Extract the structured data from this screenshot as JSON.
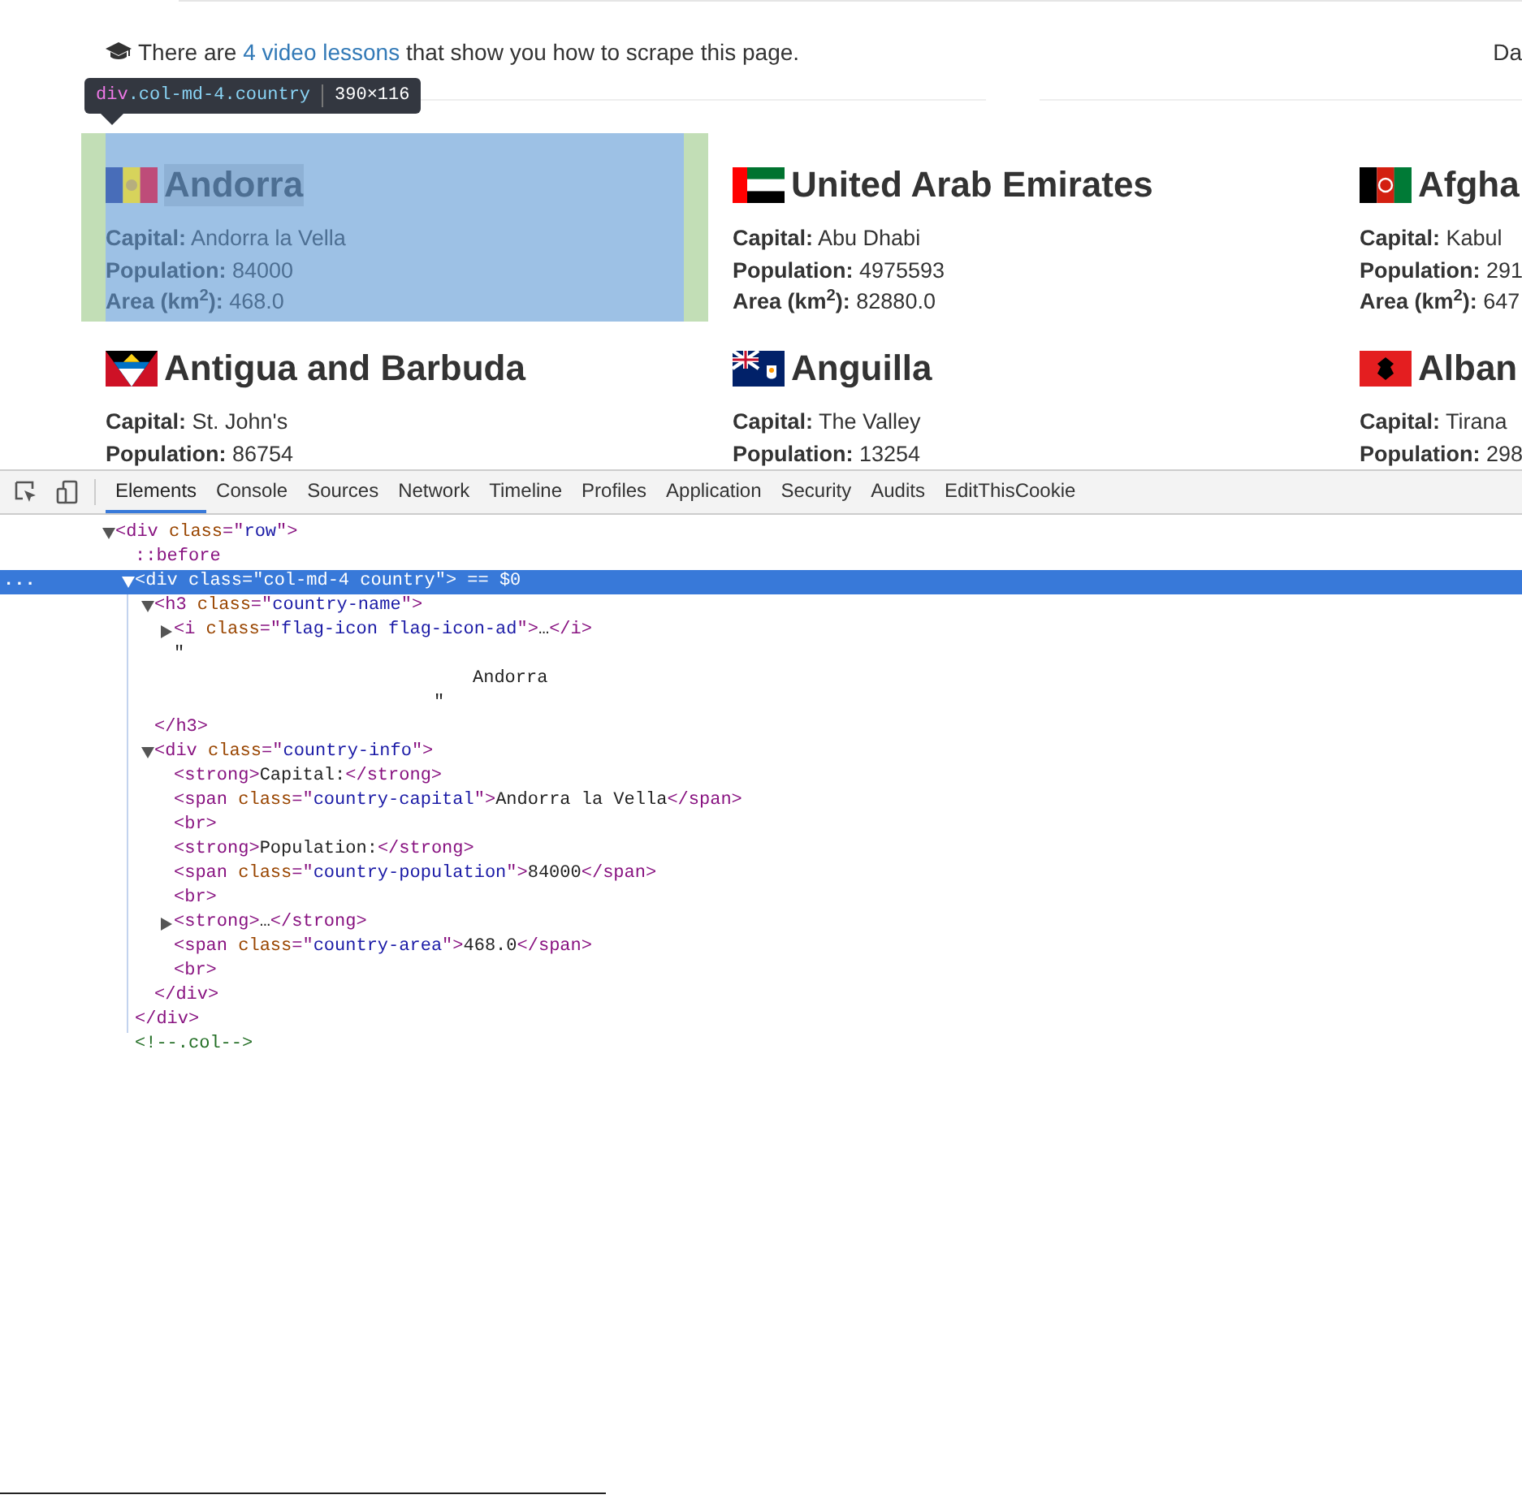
{
  "intro": {
    "before": "There are ",
    "link": "4 video lessons",
    "after": " that show you how to scrape this page.",
    "right_cut": "Da"
  },
  "tooltip": {
    "tag": "div",
    "classes": ".col-md-4.country",
    "size": "390×116"
  },
  "countries": [
    {
      "name": "Andorra",
      "highlighted": true,
      "fields": [
        {
          "label": "Capital:",
          "value": "Andorra la Vella"
        },
        {
          "label": "Population:",
          "value": "84000"
        },
        {
          "label": "Area (km$^{2}$):",
          "value": "468.0"
        }
      ]
    },
    {
      "name": "United Arab Emirates",
      "highlighted": false,
      "fields": [
        {
          "label": "Capital:",
          "value": "Abu Dhabi"
        },
        {
          "label": "Population:",
          "value": "4975593"
        },
        {
          "label": "Area (km$^{2}$):",
          "value": "82880.0"
        }
      ]
    },
    {
      "name": "Afgha",
      "highlighted": false,
      "fields": [
        {
          "label": "Capital:",
          "value": "Kabul"
        },
        {
          "label": "Population:",
          "value": "291"
        },
        {
          "label": "Area (km$^{2}$):",
          "value": "647"
        }
      ]
    },
    {
      "name": "Antigua and Barbuda",
      "highlighted": false,
      "fields": [
        {
          "label": "Capital:",
          "value": "St. John's"
        },
        {
          "label": "Population:",
          "value": "86754"
        }
      ]
    },
    {
      "name": "Anguilla",
      "highlighted": false,
      "fields": [
        {
          "label": "Capital:",
          "value": "The Valley"
        },
        {
          "label": "Population:",
          "value": "13254"
        }
      ]
    },
    {
      "name": "Alban",
      "highlighted": false,
      "fields": [
        {
          "label": "Capital:",
          "value": "Tirana"
        },
        {
          "label": "Population:",
          "value": "298"
        }
      ]
    }
  ],
  "devtools_tabs": [
    {
      "label": "Elements",
      "selected": true
    },
    {
      "label": "Console",
      "selected": false
    },
    {
      "label": "Sources",
      "selected": false
    },
    {
      "label": "Network",
      "selected": false
    },
    {
      "label": "Timeline",
      "selected": false
    },
    {
      "label": "Profiles",
      "selected": false
    },
    {
      "label": "Application",
      "selected": false
    },
    {
      "label": "Security",
      "selected": false
    },
    {
      "label": "Audits",
      "selected": false
    },
    {
      "label": "EditThisCookie",
      "selected": false
    }
  ],
  "dom_tree": [
    {
      "kind": "element",
      "expanded": true,
      "selected": false,
      "tokens": [
        {
          "kind": "tag",
          "text": "<div"
        },
        {
          "kind": "attr",
          "text": " class"
        },
        {
          "kind": "punct",
          "text": "=\""
        },
        {
          "kind": "val",
          "text": "row"
        },
        {
          "kind": "punct",
          "text": "\">"
        }
      ],
      "children": [
        {
          "kind": "pseudo",
          "selected": false,
          "tokens": [
            {
              "kind": "pseudo",
              "text": "::before"
            }
          ]
        },
        {
          "kind": "element",
          "expanded": true,
          "selected": true,
          "marker": "...",
          "tokens": [
            {
              "kind": "tag",
              "text": "<div"
            },
            {
              "kind": "attr",
              "text": " class"
            },
            {
              "kind": "punct",
              "text": "=\""
            },
            {
              "kind": "val",
              "text": "col-md-4 country"
            },
            {
              "kind": "punct",
              "text": "\">"
            },
            {
              "kind": "ref",
              "text": " == $0"
            }
          ],
          "children": [
            {
              "kind": "element",
              "expanded": true,
              "selected": false,
              "tokens": [
                {
                  "kind": "tag",
                  "text": "<h3"
                },
                {
                  "kind": "attr",
                  "text": " class"
                },
                {
                  "kind": "punct",
                  "text": "=\""
                },
                {
                  "kind": "val",
                  "text": "country-name"
                },
                {
                  "kind": "punct",
                  "text": "\">"
                }
              ],
              "children": [
                {
                  "kind": "element",
                  "expanded": false,
                  "selected": false,
                  "tokens": [
                    {
                      "kind": "tag",
                      "text": "<i"
                    },
                    {
                      "kind": "attr",
                      "text": " class"
                    },
                    {
                      "kind": "punct",
                      "text": "=\""
                    },
                    {
                      "kind": "val",
                      "text": "flag-icon flag-icon-ad"
                    },
                    {
                      "kind": "punct",
                      "text": "\">"
                    },
                    {
                      "kind": "text",
                      "text": "…"
                    },
                    {
                      "kind": "tag",
                      "text": "</i>"
                    }
                  ]
                },
                {
                  "kind": "text",
                  "selected": false,
                  "lines": [
                    "\"",
                    "Andorra",
                    "\""
                  ]
                }
              ],
              "closing": [
                {
                  "kind": "tag",
                  "text": "</h3>"
                }
              ]
            },
            {
              "kind": "element",
              "expanded": true,
              "selected": false,
              "tokens": [
                {
                  "kind": "tag",
                  "text": "<div"
                },
                {
                  "kind": "attr",
                  "text": " class"
                },
                {
                  "kind": "punct",
                  "text": "=\""
                },
                {
                  "kind": "val",
                  "text": "country-info"
                },
                {
                  "kind": "punct",
                  "text": "\">"
                }
              ],
              "children": [
                {
                  "kind": "element",
                  "selected": false,
                  "tokens": [
                    {
                      "kind": "tag",
                      "text": "<strong>"
                    },
                    {
                      "kind": "text",
                      "text": "Capital:"
                    },
                    {
                      "kind": "tag",
                      "text": "</strong>"
                    }
                  ]
                },
                {
                  "kind": "element",
                  "selected": false,
                  "tokens": [
                    {
                      "kind": "tag",
                      "text": "<span"
                    },
                    {
                      "kind": "attr",
                      "text": " class"
                    },
                    {
                      "kind": "punct",
                      "text": "=\""
                    },
                    {
                      "kind": "val",
                      "text": "country-capital"
                    },
                    {
                      "kind": "punct",
                      "text": "\">"
                    },
                    {
                      "kind": "text",
                      "text": "Andorra la Vella"
                    },
                    {
                      "kind": "tag",
                      "text": "</span>"
                    }
                  ]
                },
                {
                  "kind": "element",
                  "selected": false,
                  "tokens": [
                    {
                      "kind": "tag",
                      "text": "<br>"
                    }
                  ]
                },
                {
                  "kind": "element",
                  "selected": false,
                  "tokens": [
                    {
                      "kind": "tag",
                      "text": "<strong>"
                    },
                    {
                      "kind": "text",
                      "text": "Population:"
                    },
                    {
                      "kind": "tag",
                      "text": "</strong>"
                    }
                  ]
                },
                {
                  "kind": "element",
                  "selected": false,
                  "tokens": [
                    {
                      "kind": "tag",
                      "text": "<span"
                    },
                    {
                      "kind": "attr",
                      "text": " class"
                    },
                    {
                      "kind": "punct",
                      "text": "=\""
                    },
                    {
                      "kind": "val",
                      "text": "country-population"
                    },
                    {
                      "kind": "punct",
                      "text": "\">"
                    },
                    {
                      "kind": "text",
                      "text": "84000"
                    },
                    {
                      "kind": "tag",
                      "text": "</span>"
                    }
                  ]
                },
                {
                  "kind": "element",
                  "selected": false,
                  "tokens": [
                    {
                      "kind": "tag",
                      "text": "<br>"
                    }
                  ]
                },
                {
                  "kind": "element",
                  "expanded": false,
                  "selected": false,
                  "tokens": [
                    {
                      "kind": "tag",
                      "text": "<strong>"
                    },
                    {
                      "kind": "text",
                      "text": "…"
                    },
                    {
                      "kind": "tag",
                      "text": "</strong>"
                    }
                  ]
                },
                {
                  "kind": "element",
                  "selected": false,
                  "tokens": [
                    {
                      "kind": "tag",
                      "text": "<span"
                    },
                    {
                      "kind": "attr",
                      "text": " class"
                    },
                    {
                      "kind": "punct",
                      "text": "=\""
                    },
                    {
                      "kind": "val",
                      "text": "country-area"
                    },
                    {
                      "kind": "punct",
                      "text": "\">"
                    },
                    {
                      "kind": "text",
                      "text": "468.0"
                    },
                    {
                      "kind": "tag",
                      "text": "</span>"
                    }
                  ]
                },
                {
                  "kind": "element",
                  "selected": false,
                  "tokens": [
                    {
                      "kind": "tag",
                      "text": "<br>"
                    }
                  ]
                }
              ],
              "closing": [
                {
                  "kind": "tag",
                  "text": "</div>"
                }
              ]
            }
          ],
          "closing": [
            {
              "kind": "tag",
              "text": "</div>"
            }
          ]
        },
        {
          "kind": "comment",
          "selected": false,
          "tokens": [
            {
              "kind": "comment",
              "text": "<!--.col-->"
            }
          ]
        }
      ]
    }
  ]
}
